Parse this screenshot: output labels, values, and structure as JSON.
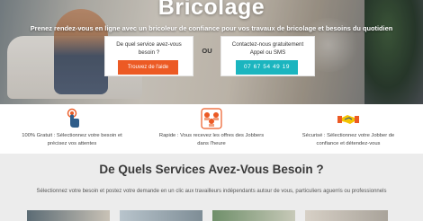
{
  "hero": {
    "brand": "Bricolage",
    "tagline": "Prenez rendez-vous en ligne avec un bricoleur de confiance pour vos travaux de bricolage et besoins du quotidien",
    "left_card": {
      "question_line1": "De quel service avez-vous",
      "question_line2": "besoin ?",
      "button_label": "Trouvez de l'aide"
    },
    "or_label": "OU",
    "right_card": {
      "text_line1": "Contactez-nous gratuitement",
      "text_line2": "Appel ou SMS",
      "phone_label": "07 67 54 49 19"
    }
  },
  "features": [
    {
      "icon": "touch-icon",
      "line1": "100% Gratuit : Sélectionnez votre besoin et",
      "line2": "précisez vos attentes"
    },
    {
      "icon": "team-icon",
      "line1": "Rapide : Vous recevez les offres des Jobbers",
      "line2": "dans l'heure"
    },
    {
      "icon": "handshake-icon",
      "line1": "Sécurisé : Sélectionnez votre Jobber de",
      "line2": "confiance et détendez-vous"
    }
  ],
  "services": {
    "title": "De Quels Services Avez-Vous Besoin ?",
    "description": "Sélectionnez votre besoin et postez votre demande en un clic aux travailleurs indépendants autour de vous, particuliers aguerris ou professionnels"
  },
  "colors": {
    "accent_orange": "#ec5a24",
    "accent_teal": "#1bb5bf",
    "services_bg": "#ececec"
  }
}
